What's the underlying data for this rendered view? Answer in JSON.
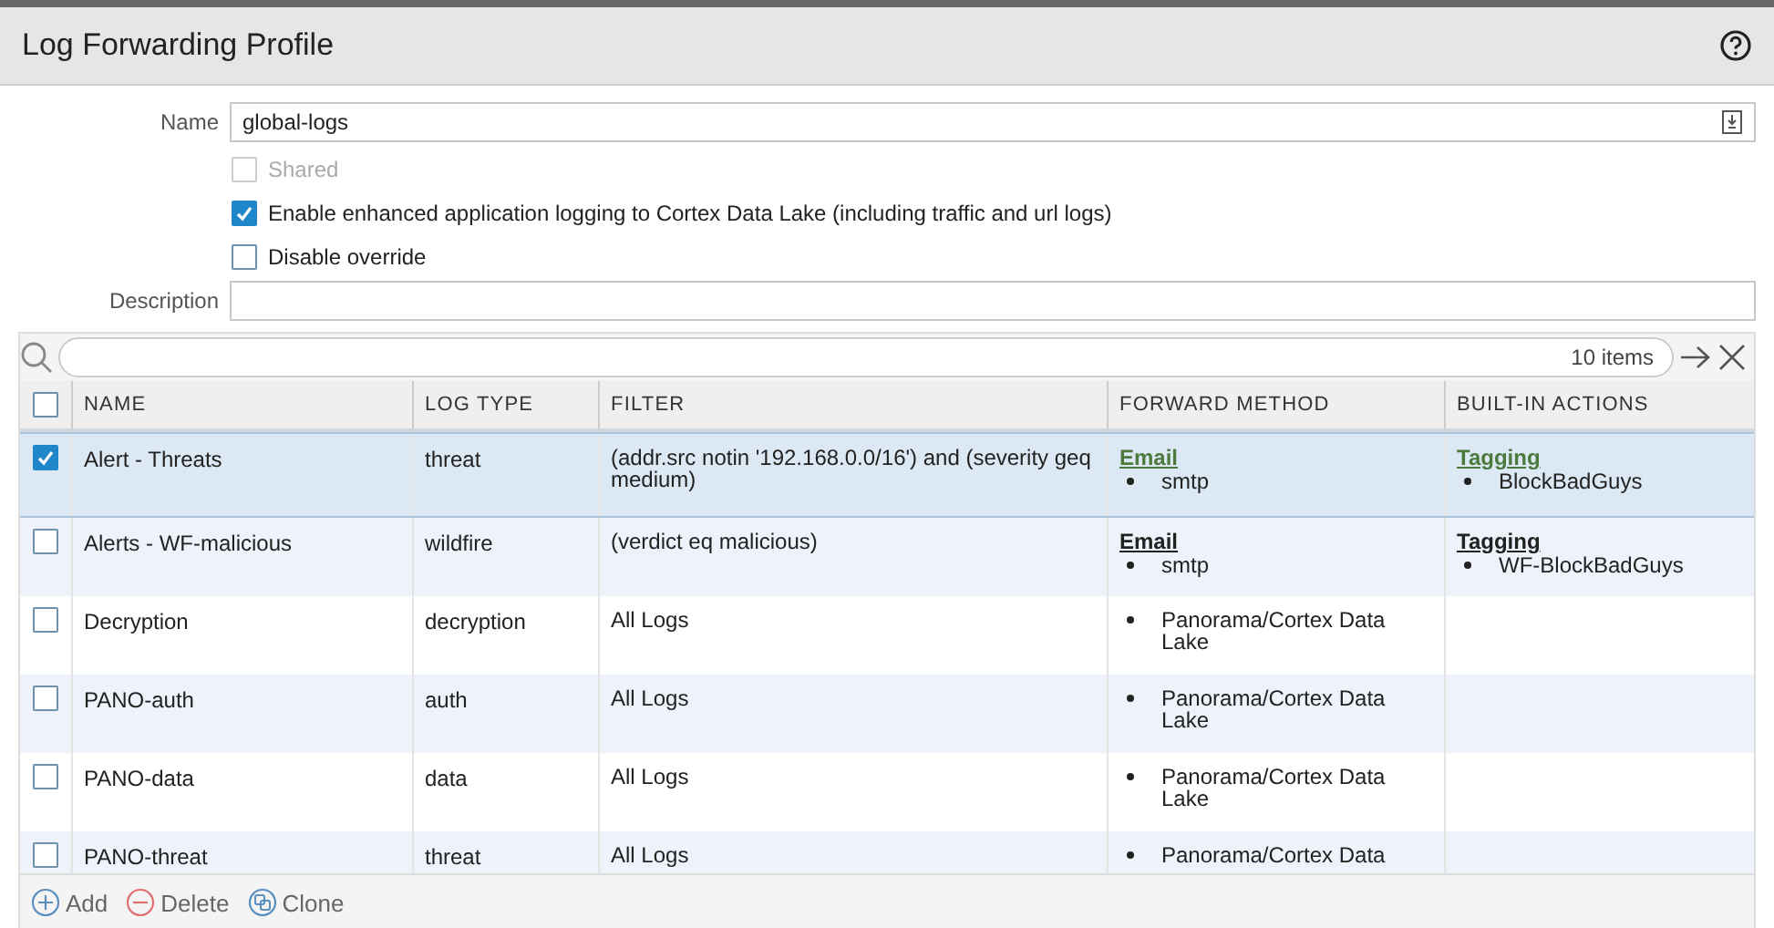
{
  "dialog": {
    "title": "Log Forwarding Profile"
  },
  "form": {
    "name": {
      "label": "Name",
      "value": "global-logs"
    },
    "checkboxes": [
      {
        "label": "Shared",
        "checked": false,
        "disabled": true
      },
      {
        "label": "Enable enhanced application logging to Cortex Data Lake (including traffic and url logs)",
        "checked": true,
        "disabled": false
      },
      {
        "label": "Disable override",
        "checked": false,
        "disabled": false
      }
    ],
    "description": {
      "label": "Description"
    }
  },
  "table": {
    "count": "10 items",
    "columns": [
      "NAME",
      "LOG TYPE",
      "FILTER",
      "FORWARD METHOD",
      "BUILT-IN ACTIONS"
    ],
    "header_checked": false,
    "rows": [
      {
        "selected": true,
        "name": "Alert - Threats",
        "log_type": "threat",
        "filter": "(addr.src notin '192.168.0.0/16') and (severity geq medium)",
        "forward": {
          "method": "Email",
          "items": [
            "smtp"
          ]
        },
        "actions": {
          "method": "Tagging",
          "items": [
            "BlockBadGuys"
          ]
        }
      },
      {
        "selected": false,
        "name": "Alerts - WF-malicious",
        "log_type": "wildfire",
        "filter": "(verdict eq malicious)",
        "forward": {
          "method": "Email",
          "items": [
            "smtp"
          ]
        },
        "actions": {
          "method": "Tagging",
          "items": [
            "WF-BlockBadGuys"
          ]
        }
      },
      {
        "selected": false,
        "name": "Decryption",
        "log_type": "decryption",
        "filter": "All Logs",
        "forward": {
          "items": [
            "Panorama/Cortex Data Lake"
          ]
        }
      },
      {
        "selected": false,
        "name": "PANO-auth",
        "log_type": "auth",
        "filter": "All Logs",
        "forward": {
          "items": [
            "Panorama/Cortex Data Lake"
          ]
        }
      },
      {
        "selected": false,
        "name": "PANO-data",
        "log_type": "data",
        "filter": "All Logs",
        "forward": {
          "items": [
            "Panorama/Cortex Data Lake"
          ]
        }
      },
      {
        "selected": false,
        "name": "PANO-threat",
        "log_type": "threat",
        "filter": "All Logs",
        "forward": {
          "items": [
            "Panorama/Cortex Data"
          ]
        }
      }
    ],
    "actions": [
      "Add",
      "Delete",
      "Clone"
    ]
  }
}
